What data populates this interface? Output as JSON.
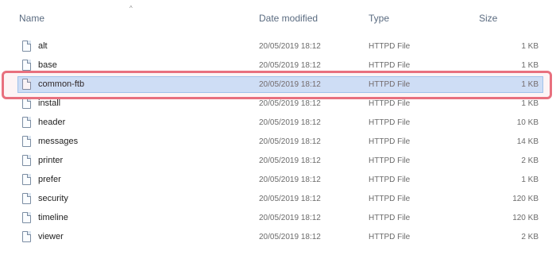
{
  "columns": {
    "name": "Name",
    "date_modified": "Date modified",
    "type": "Type",
    "size": "Size"
  },
  "sort_indicator": "^",
  "files": [
    {
      "name": "alt",
      "date": "20/05/2019 18:12",
      "type": "HTTPD File",
      "size": "1 KB"
    },
    {
      "name": "base",
      "date": "20/05/2019 18:12",
      "type": "HTTPD File",
      "size": "1 KB"
    },
    {
      "name": "common-ftb",
      "date": "20/05/2019 18:12",
      "type": "HTTPD File",
      "size": "1 KB"
    },
    {
      "name": "install",
      "date": "20/05/2019 18:12",
      "type": "HTTPD File",
      "size": "1 KB"
    },
    {
      "name": "header",
      "date": "20/05/2019 18:12",
      "type": "HTTPD File",
      "size": "10 KB"
    },
    {
      "name": "messages",
      "date": "20/05/2019 18:12",
      "type": "HTTPD File",
      "size": "14 KB"
    },
    {
      "name": "printer",
      "date": "20/05/2019 18:12",
      "type": "HTTPD File",
      "size": "2 KB"
    },
    {
      "name": "prefer",
      "date": "20/05/2019 18:12",
      "type": "HTTPD File",
      "size": "1 KB"
    },
    {
      "name": "security",
      "date": "20/05/2019 18:12",
      "type": "HTTPD File",
      "size": "120 KB"
    },
    {
      "name": "timeline",
      "date": "20/05/2019 18:12",
      "type": "HTTPD File",
      "size": "120 KB"
    },
    {
      "name": "viewer",
      "date": "20/05/2019 18:12",
      "type": "HTTPD File",
      "size": "2 KB"
    }
  ],
  "selected_index": 2,
  "colors": {
    "selection_fill": "#cce6ff",
    "highlight_border": "#e8707e"
  }
}
